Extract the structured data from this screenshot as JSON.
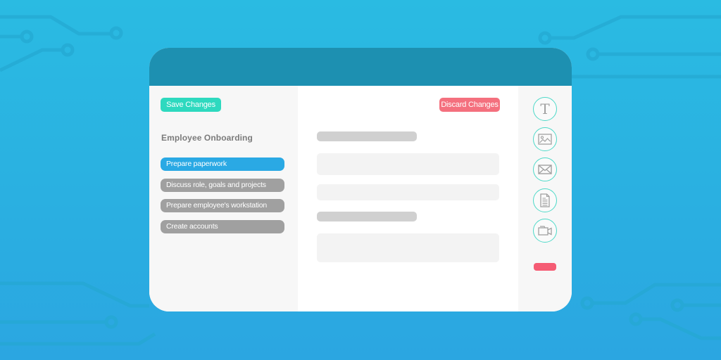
{
  "theme": {
    "background": "#2ab4e1",
    "header_color": "#1d90b1",
    "save_color": "#2ed9bf",
    "discard_color": "#f4707e",
    "active_step_color": "#2aa9e4",
    "inactive_step_color": "#a0a0a0",
    "tool_ring_color": "#4dd9c8",
    "delete_color": "#f55c74"
  },
  "toolbar": {
    "save_label": "Save Changes",
    "discard_label": "Discard Changes"
  },
  "sidebar": {
    "title": "Employee Onboarding",
    "steps": [
      {
        "label": "Prepare paperwork",
        "active": true
      },
      {
        "label": "Discuss role, goals and projects",
        "active": false
      },
      {
        "label": "Prepare employee's workstation",
        "active": false
      },
      {
        "label": "Create accounts",
        "active": false
      }
    ]
  },
  "tools": [
    {
      "icon": "text-icon",
      "glyph": "T"
    },
    {
      "icon": "image-icon"
    },
    {
      "icon": "email-icon"
    },
    {
      "icon": "document-icon"
    },
    {
      "icon": "video-icon"
    }
  ]
}
